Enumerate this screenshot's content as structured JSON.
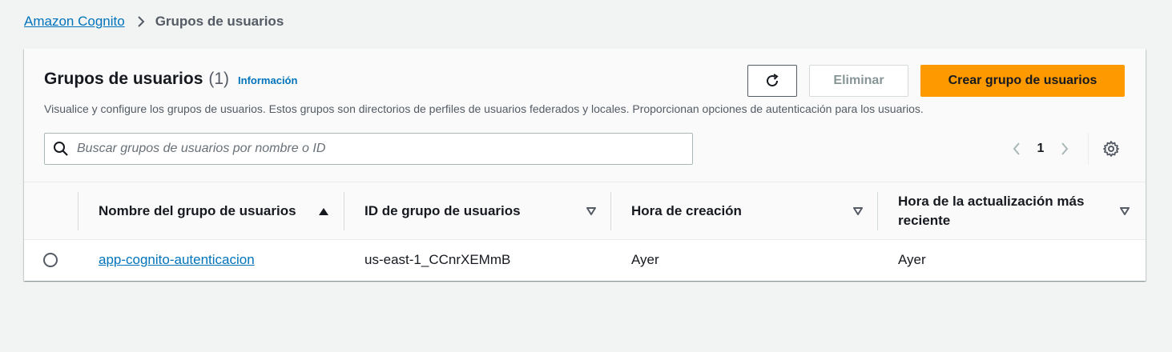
{
  "breadcrumb": {
    "root": "Amazon Cognito",
    "current": "Grupos de usuarios"
  },
  "panel": {
    "title": "Grupos de usuarios",
    "count": "(1)",
    "info_link": "Información",
    "description": "Visualice y configure los grupos de usuarios. Estos grupos son directorios de perfiles de usuarios federados y locales. Proporcionan opciones de autenticación para los usuarios.",
    "buttons": {
      "refresh_icon": "refresh-icon",
      "delete_label": "Eliminar",
      "create_label": "Crear grupo de usuarios"
    },
    "search": {
      "placeholder": "Buscar grupos de usuarios por nombre o ID",
      "value": ""
    },
    "pagination": {
      "current_page": "1"
    }
  },
  "table": {
    "columns": [
      {
        "label": "Nombre del grupo de usuarios",
        "sort": "ascending"
      },
      {
        "label": "ID de grupo de usuarios",
        "sort": "none"
      },
      {
        "label": "Hora de creación",
        "sort": "none"
      },
      {
        "label": "Hora de la actualización más reciente",
        "sort": "none"
      }
    ],
    "rows": [
      {
        "selected": false,
        "name": "app-cognito-autenticacion",
        "id": "us-east-1_CCnrXEMmB",
        "created": "Ayer",
        "updated": "Ayer"
      }
    ]
  },
  "colors": {
    "link": "#0073bb",
    "primary_button": "#ff9900",
    "background": "#f2f3f3"
  }
}
